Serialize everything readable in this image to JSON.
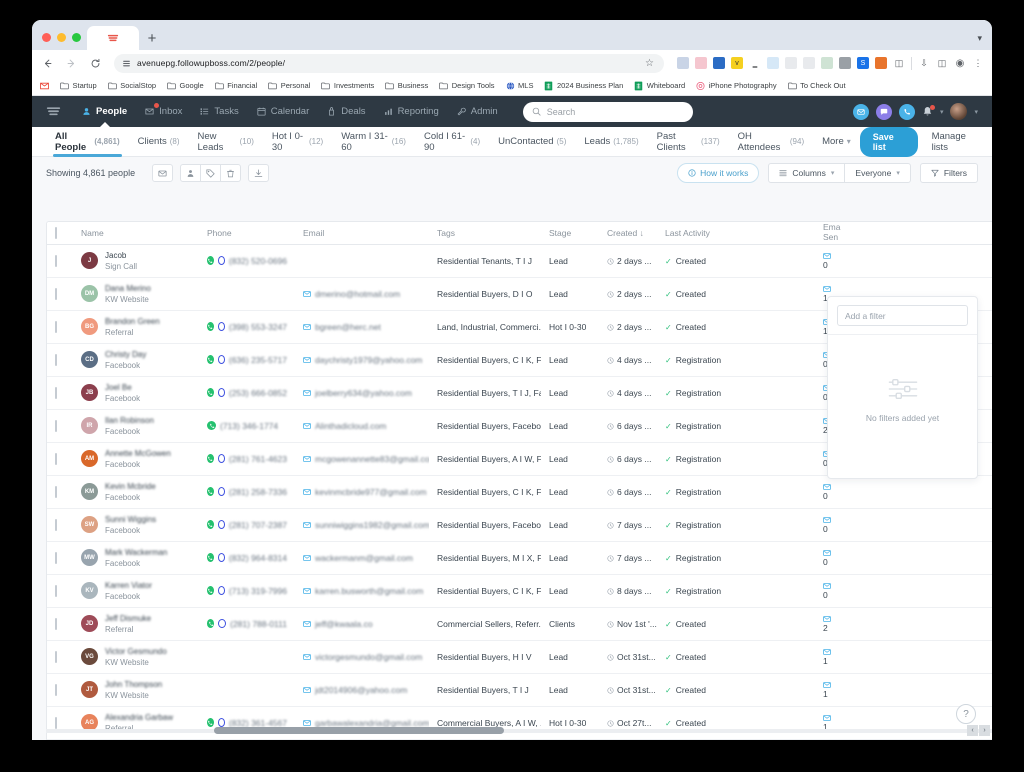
{
  "browser": {
    "tab_favicon": "followupboss-favicon",
    "new_tab_label": "+",
    "url": "avenuepg.followupboss.com/2/people/",
    "bookmarks": [
      {
        "label": "",
        "icon": "gmail-icon",
        "color": "#ea4335"
      },
      {
        "label": "Startup",
        "icon": "folder-icon",
        "color": "#5f6368"
      },
      {
        "label": "SocialStop",
        "icon": "folder-icon",
        "color": "#5f6368"
      },
      {
        "label": "Google",
        "icon": "folder-icon",
        "color": "#5f6368"
      },
      {
        "label": "Financial",
        "icon": "folder-icon",
        "color": "#5f6368"
      },
      {
        "label": "Personal",
        "icon": "folder-icon",
        "color": "#5f6368"
      },
      {
        "label": "Investments",
        "icon": "folder-icon",
        "color": "#5f6368"
      },
      {
        "label": "Business",
        "icon": "folder-icon",
        "color": "#5f6368"
      },
      {
        "label": "Design Tools",
        "icon": "folder-icon",
        "color": "#5f6368"
      },
      {
        "label": "MLS",
        "icon": "globe-icon",
        "color": "#2d5bc4"
      },
      {
        "label": "2024 Business Plan",
        "icon": "sheets-icon",
        "color": "#0f9d58"
      },
      {
        "label": "Whiteboard",
        "icon": "sheets-icon",
        "color": "#0f9d58"
      },
      {
        "label": "iPhone Photography",
        "icon": "camera-icon",
        "color": "#eb5a7a"
      },
      {
        "label": "To Check Out",
        "icon": "folder-icon",
        "color": "#5f6368"
      }
    ],
    "extensions": [
      {
        "name": "cloud-icon",
        "color": "#c9d4e6",
        "glyph": ""
      },
      {
        "name": "pocket-icon",
        "color": "#f5c6cf",
        "glyph": ""
      },
      {
        "name": "pen-icon",
        "color": "#2b6cc4",
        "glyph": ""
      },
      {
        "name": "v-icon",
        "color": "#f5d020",
        "glyph": "v"
      },
      {
        "name": "script-icon",
        "color": "#ffffff",
        "glyph": ""
      },
      {
        "name": "clock-icon",
        "color": "#d6e8f7",
        "glyph": ""
      },
      {
        "name": "note-icon",
        "color": "#e8eaed",
        "glyph": ""
      },
      {
        "name": "grid-icon",
        "color": "#e8eaed",
        "glyph": ""
      },
      {
        "name": "image-icon",
        "color": "#cfe3d4",
        "glyph": ""
      },
      {
        "name": "bug-icon",
        "color": "#9aa0a6",
        "glyph": ""
      },
      {
        "name": "s-icon",
        "color": "#1a73e8",
        "glyph": "S"
      },
      {
        "name": "orange-icon",
        "color": "#e8742c",
        "glyph": ""
      },
      {
        "name": "puzzle-icon",
        "color": "#ffffff",
        "glyph": ""
      }
    ],
    "right_icons": [
      "download-icon",
      "sidepanel-icon",
      "profile-icon",
      "menu-icon"
    ]
  },
  "appnav": {
    "logo": "followupboss-logo",
    "items": [
      {
        "label": "People",
        "icon": "person-icon",
        "active": true,
        "badge": false
      },
      {
        "label": "Inbox",
        "icon": "inbox-icon",
        "active": false,
        "badge": true
      },
      {
        "label": "Tasks",
        "icon": "tasks-icon",
        "active": false,
        "badge": false
      },
      {
        "label": "Calendar",
        "icon": "calendar-icon",
        "active": false,
        "badge": false
      },
      {
        "label": "Deals",
        "icon": "deals-icon",
        "active": false,
        "badge": false
      },
      {
        "label": "Reporting",
        "icon": "reporting-icon",
        "active": false,
        "badge": false
      },
      {
        "label": "Admin",
        "icon": "admin-icon",
        "active": false,
        "badge": false
      }
    ],
    "search_placeholder": "Search",
    "right_actions": [
      {
        "name": "email-action",
        "icon": "envelope-icon",
        "color": "#4ab3e8"
      },
      {
        "name": "message-action",
        "icon": "chat-icon",
        "color": "#8c7ee8"
      },
      {
        "name": "call-action",
        "icon": "phone-icon",
        "color": "#4ab3e8"
      },
      {
        "name": "notifications",
        "icon": "bell-icon",
        "color": "#c8d0d7"
      }
    ]
  },
  "listtabs": {
    "items": [
      {
        "label": "All People",
        "count": "(4,861)",
        "active": true
      },
      {
        "label": "Clients",
        "count": "(8)",
        "active": false
      },
      {
        "label": "New Leads",
        "count": "(10)",
        "active": false
      },
      {
        "label": "Hot I 0-30",
        "count": "(12)",
        "active": false
      },
      {
        "label": "Warm I 31-60",
        "count": "(16)",
        "active": false
      },
      {
        "label": "Cold I 61-90",
        "count": "(4)",
        "active": false
      },
      {
        "label": "UnContacted",
        "count": "(5)",
        "active": false
      },
      {
        "label": "Leads",
        "count": "(1,785)",
        "active": false
      },
      {
        "label": "Past Clients",
        "count": "(137)",
        "active": false
      },
      {
        "label": "OH Attendees",
        "count": "(94)",
        "active": false
      },
      {
        "label": "More",
        "count": "",
        "active": false,
        "chevron": true
      }
    ],
    "save_list_label": "Save list",
    "manage_lists_label": "Manage lists"
  },
  "toolbar": {
    "showing_label": "Showing 4,861 people",
    "actions": [
      {
        "name": "email-bulk-button",
        "icon": "envelope-icon"
      },
      {
        "name": "assign-button",
        "icon": "person-arrow-icon"
      },
      {
        "name": "tag-button",
        "icon": "tag-icon"
      },
      {
        "name": "delete-button",
        "icon": "trash-icon"
      },
      {
        "name": "export-button",
        "icon": "download-icon"
      }
    ],
    "how_it_works_label": "How it works",
    "columns_label": "Columns",
    "everyone_label": "Everyone",
    "filters_label": "Filters"
  },
  "table": {
    "headers": [
      "",
      "Name",
      "Phone",
      "Email",
      "Tags",
      "Stage",
      "Created",
      "Last Activity",
      "Email Sent",
      ""
    ],
    "sort_column": "Created",
    "sort_dir": "desc",
    "rows": [
      {
        "initials": "J",
        "avatar_color": "#7c3a43",
        "name": "Jacob",
        "name_clear": true,
        "source": "Sign Call",
        "phone": "(832) 520-0696",
        "has_phone": true,
        "has_whatsapp": true,
        "email": "",
        "tags": "Residential Tenants, T I J",
        "stage": "Lead",
        "created": "2 days ...",
        "activity": "Created",
        "email_sent": "0"
      },
      {
        "initials": "DM",
        "avatar_color": "#9bc3a8",
        "name": "Dana Merino",
        "source": "KW Website",
        "phone": "",
        "has_phone": false,
        "has_whatsapp": false,
        "email": "dmerino@hotmail.com",
        "tags": "Residential Buyers, D I O",
        "stage": "Lead",
        "created": "2 days ...",
        "activity": "Created",
        "email_sent": "1"
      },
      {
        "initials": "BG",
        "avatar_color": "#f09a7e",
        "name": "Brandon Green",
        "source": "Referral",
        "phone": "(398) 553-3247",
        "has_phone": true,
        "has_whatsapp": true,
        "email": "bgreen@herc.net",
        "tags": "Land, Industrial, Commerci...",
        "stage": "Hot I 0-30",
        "created": "2 days ...",
        "activity": "Created",
        "email_sent": "1"
      },
      {
        "initials": "CD",
        "avatar_color": "#5b6e85",
        "name": "Christy Day",
        "source": "Facebook",
        "phone": "(636) 235-5717",
        "has_phone": true,
        "has_whatsapp": true,
        "email": "daychristy1979@yahoo.com",
        "tags": "Residential Buyers, C I K, F...",
        "stage": "Lead",
        "created": "4 days ...",
        "activity": "Registration",
        "email_sent": "0"
      },
      {
        "initials": "JB",
        "avatar_color": "#8c3f4d",
        "name": "Joel Be",
        "source": "Facebook",
        "phone": "(253) 666-0852",
        "has_phone": true,
        "has_whatsapp": true,
        "email": "joelberry634@yahoo.com",
        "tags": "Residential Buyers, T I J, Fa...",
        "stage": "Lead",
        "created": "4 days ...",
        "activity": "Registration",
        "email_sent": "0"
      },
      {
        "initials": "IR",
        "avatar_color": "#cfa5ab",
        "name": "Ilan Robinson",
        "source": "Facebook",
        "phone": "(713) 346-1774",
        "has_phone": true,
        "has_whatsapp": false,
        "email": "Alinthadicloud.com",
        "tags": "Residential Buyers, Facebo...",
        "stage": "Lead",
        "created": "6 days ...",
        "activity": "Registration",
        "email_sent": "2"
      },
      {
        "initials": "AM",
        "avatar_color": "#d9682a",
        "name": "Annette McGowen",
        "source": "Facebook",
        "phone": "(281) 761-4623",
        "has_phone": true,
        "has_whatsapp": true,
        "email": "mcgowenannette83@gmail.com",
        "tags": "Residential Buyers, A I W, F...",
        "stage": "Lead",
        "created": "6 days ...",
        "activity": "Registration",
        "email_sent": "0"
      },
      {
        "initials": "KM",
        "avatar_color": "#8b9a97",
        "name": "Kevin Mcbride",
        "source": "Facebook",
        "phone": "(281) 258-7336",
        "has_phone": true,
        "has_whatsapp": true,
        "email": "kevinmcbride977@gmail.com",
        "tags": "Residential Buyers, C I K, F...",
        "stage": "Lead",
        "created": "6 days ...",
        "activity": "Registration",
        "email_sent": "0"
      },
      {
        "initials": "SW",
        "avatar_color": "#dda183",
        "name": "Sunni Wiggins",
        "source": "Facebook",
        "phone": "(281) 707-2387",
        "has_phone": true,
        "has_whatsapp": true,
        "email": "sunniwiggins1982@gmail.com",
        "tags": "Residential Buyers, Facebo...",
        "stage": "Lead",
        "created": "7 days ...",
        "activity": "Registration",
        "email_sent": "0"
      },
      {
        "initials": "MW",
        "avatar_color": "#98a4ae",
        "name": "Mark Wackerman",
        "source": "Facebook",
        "phone": "(832) 964-8314",
        "has_phone": true,
        "has_whatsapp": true,
        "email": "wackermanm@gmail.com",
        "tags": "Residential Buyers, M I X, F...",
        "stage": "Lead",
        "created": "7 days ...",
        "activity": "Registration",
        "email_sent": "0"
      },
      {
        "initials": "KV",
        "avatar_color": "#aab6bd",
        "name": "Karren Viator",
        "source": "Facebook",
        "phone": "(713) 319-7996",
        "has_phone": true,
        "has_whatsapp": true,
        "email": "karren.busworth@gmail.com",
        "tags": "Residential Buyers, C I K, F...",
        "stage": "Lead",
        "created": "8 days ...",
        "activity": "Registration",
        "email_sent": "0"
      },
      {
        "initials": "JD",
        "avatar_color": "#9e4b58",
        "name": "Jeff Dismuke",
        "source": "Referral",
        "phone": "(281) 788-0111",
        "has_phone": true,
        "has_whatsapp": true,
        "email": "jeff@kwaala.co",
        "tags": "Commercial Sellers, Referr...",
        "stage": "Clients",
        "created": "Nov 1st '...",
        "activity": "Created",
        "email_sent": "2"
      },
      {
        "initials": "VG",
        "avatar_color": "#6b4a3c",
        "name": "Victor Gesmundo",
        "source": "KW Website",
        "phone": "",
        "has_phone": false,
        "has_whatsapp": false,
        "email": "victorgesmundo@gmail.com",
        "tags": "Residential Buyers, H I V",
        "stage": "Lead",
        "created": "Oct 31st...",
        "activity": "Created",
        "email_sent": "1"
      },
      {
        "initials": "JT",
        "avatar_color": "#b05a3e",
        "name": "John Thompson",
        "source": "KW Website",
        "phone": "",
        "has_phone": false,
        "has_whatsapp": false,
        "email": "jdt2014906@yahoo.com",
        "tags": "Residential Buyers, T I J",
        "stage": "Lead",
        "created": "Oct 31st...",
        "activity": "Created",
        "email_sent": "1"
      },
      {
        "initials": "AG",
        "avatar_color": "#e8835c",
        "name": "Alexandria Garbaw",
        "source": "Referral",
        "phone": "(832) 361-4567",
        "has_phone": true,
        "has_whatsapp": true,
        "email": "garbawalexandria@gmail.com",
        "tags": "Commercial Buyers, A I W, ...",
        "stage": "Hot I 0-30",
        "created": "Oct 27t...",
        "activity": "Created",
        "email_sent": "1"
      }
    ]
  },
  "filterpanel": {
    "input_placeholder": "Add a filter",
    "empty_text": "No filters added yet",
    "empty_icon": "sliders-icon"
  },
  "footer": {
    "help_label": "?",
    "scroll_left_label": "‹",
    "scroll_right_label": "›"
  },
  "colors": {
    "accent": "#2c9fd6",
    "nav_bg": "#2e3943",
    "page_bg": "#f7f8fa",
    "success": "#2fc07c"
  }
}
